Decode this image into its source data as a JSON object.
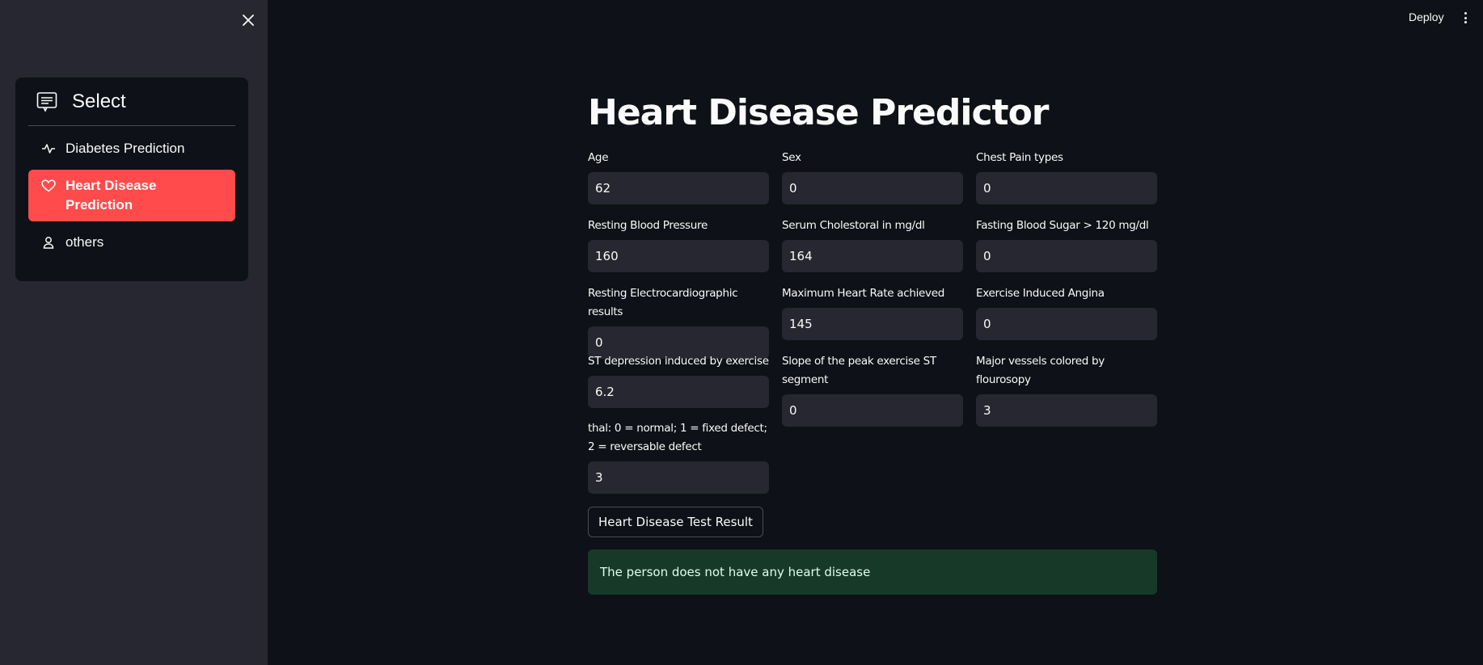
{
  "sidebar": {
    "menu_title": "Select",
    "items": [
      {
        "label": "Diabetes Prediction",
        "icon": "activity-icon"
      },
      {
        "label": "Heart Disease Prediction",
        "icon": "heart-icon"
      },
      {
        "label": "others",
        "icon": "person-icon"
      }
    ]
  },
  "header": {
    "deploy_label": "Deploy"
  },
  "main": {
    "title": "Heart Disease Predictor",
    "fields": [
      {
        "label": "Age",
        "value": "62"
      },
      {
        "label": "Sex",
        "value": "0"
      },
      {
        "label": "Chest Pain types",
        "value": "0"
      },
      {
        "label": "Resting Blood Pressure",
        "value": "160"
      },
      {
        "label": "Serum Cholestoral in mg/dl",
        "value": "164"
      },
      {
        "label": "Fasting Blood Sugar > 120 mg/dl",
        "value": "0"
      },
      {
        "label": "Resting Electrocardiographic results",
        "value": "0"
      },
      {
        "label": "Maximum Heart Rate achieved",
        "value": "145"
      },
      {
        "label": "Exercise Induced Angina",
        "value": "0"
      },
      {
        "label": "ST depression induced by exercise",
        "value": "6.2"
      },
      {
        "label": "Slope of the peak exercise ST segment",
        "value": "0"
      },
      {
        "label": "Major vessels colored by flourosopy",
        "value": "3"
      },
      {
        "label": "thal: 0 = normal; 1 = fixed defect; 2 = reversable defect",
        "value": "3"
      }
    ],
    "submit_label": "Heart Disease Test Result",
    "result_text": "The person does not have any heart disease"
  },
  "colors": {
    "accent": "#ff4b4b",
    "sidebar_bg": "#262730",
    "main_bg": "#0e1117",
    "success_bg": "#173928"
  }
}
